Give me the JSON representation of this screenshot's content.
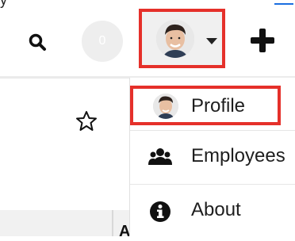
{
  "topbar": {
    "clipped_text": "y",
    "counter_value": "0"
  },
  "icons": {
    "search": "search-icon",
    "star": "star-icon",
    "plus": "plus-icon",
    "caret": "caret-down-icon",
    "employees": "users-icon",
    "about": "info-icon"
  },
  "user_menu": {
    "items": [
      {
        "label": "Profile"
      },
      {
        "label": "Employees"
      },
      {
        "label": "About"
      }
    ]
  },
  "colors": {
    "highlight": "#e5302a",
    "link": "#1a6ee0"
  },
  "footer_strip": {
    "clipped_text": "A"
  }
}
